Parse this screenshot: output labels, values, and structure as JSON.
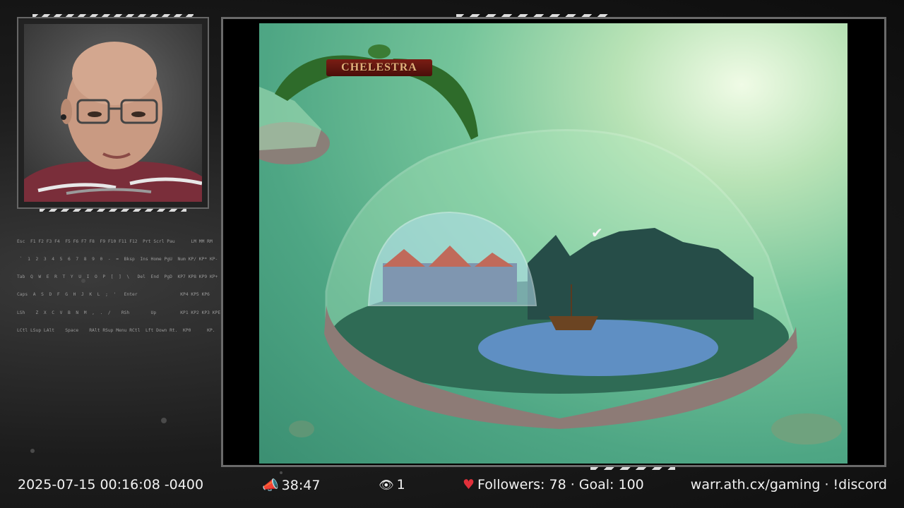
{
  "game": {
    "logo_text": "CHELESTRA"
  },
  "keyboard_overlay": {
    "rows": [
      "Esc  F1 F2 F3 F4  F5 F6 F7 F8  F9 F10 F11 F12  Prt Scrl Pau      LM MM RM",
      " `  1  2  3  4  5  6  7  8  9  0  -  =  Bksp  Ins Home PgU  Num KP/ KP* KP-",
      "Tab  Q  W  E  R  T  Y  U  I  O  P  [  ]  \\   Del  End  PgD  KP7 KP8 KP9 KP+",
      "Caps  A  S  D  F  G  H  J  K  L  ;  '   Enter                KP4 KP5 KP6",
      "LSh    Z  X  C  V  B  N  M  ,  .  /    RSh        Up         KP1 KP2 KP3 KPE",
      "LCtl LSup LAlt    Space    RAlt RSup Menu RCtl  Lft Down Rt.  KP0      KP."
    ]
  },
  "status_bar": {
    "datetime": "2025-07-15 00:16:08 -0400",
    "uptime_icon": "megaphone-icon",
    "uptime": "38:47",
    "viewers_icon": "eye-icon",
    "viewers": "1",
    "followers_icon": "heart-icon",
    "followers": "Followers: 78 · Goal: 100",
    "links": "warr.ath.cx/gaming · !discord"
  },
  "colors": {
    "accent_heart": "#e0303a",
    "uptime_icon": "#e85a3a",
    "game_sea": "#5aae8a"
  }
}
